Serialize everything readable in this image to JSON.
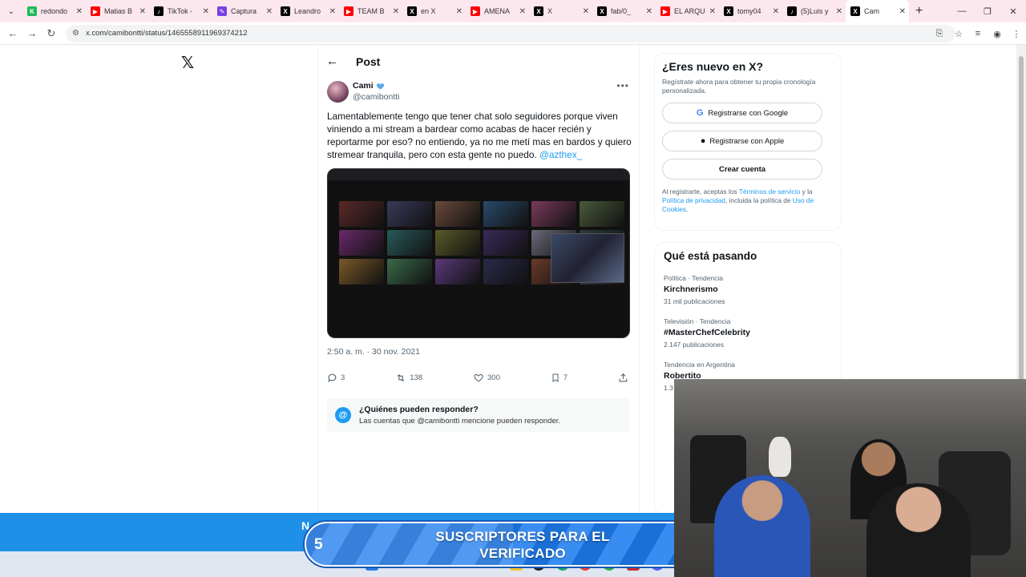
{
  "browser": {
    "tabs": [
      {
        "title": "redondo",
        "color": "#1db954",
        "glyph": "K"
      },
      {
        "title": "Matias B",
        "color": "#ff0000",
        "glyph": "▶"
      },
      {
        "title": "TikTok -",
        "color": "#000000",
        "glyph": "♪"
      },
      {
        "title": "Captura",
        "color": "#7b3fe4",
        "glyph": "✎"
      },
      {
        "title": "Leandro",
        "color": "#000000",
        "glyph": "X"
      },
      {
        "title": "TEAM B",
        "color": "#ff0000",
        "glyph": "▶"
      },
      {
        "title": "en X",
        "color": "#000000",
        "glyph": "X"
      },
      {
        "title": "AMENA",
        "color": "#ff0000",
        "glyph": "▶"
      },
      {
        "title": "X",
        "color": "#000000",
        "glyph": "X"
      },
      {
        "title": "fab/0_",
        "color": "#000000",
        "glyph": "X"
      },
      {
        "title": "EL ARQU",
        "color": "#ff0000",
        "glyph": "▶"
      },
      {
        "title": "tomy04",
        "color": "#000000",
        "glyph": "X"
      },
      {
        "title": "(5)Luis y",
        "color": "#000000",
        "glyph": "♪"
      },
      {
        "title": "Cam",
        "color": "#000000",
        "glyph": "X"
      }
    ],
    "url": "x.com/camibontti/status/1465558911969374212"
  },
  "page": {
    "header_title": "Post",
    "author_name": "Cami",
    "author_handle": "@camibontti",
    "post_text": "Lamentablemente tengo que tener chat solo seguidores porque viven viniendo a mi stream a bardear como acabas de hacer recién y reportarme por eso? no entiendo, ya no me metí mas en bardos y quiero stremear tranquila, pero con esta gente no puedo. ",
    "post_mention": "@azthex_",
    "timestamp": "2:50 a. m. · 30 nov. 2021",
    "replies": "3",
    "reposts": "138",
    "likes": "300",
    "bookmarks": "7",
    "reply_title": "¿Quiénes pueden responder?",
    "reply_sub": "Las cuentas que @camibontti mencione pueden responder."
  },
  "signup": {
    "title": "¿Eres nuevo en X?",
    "subtitle": "Regístrate ahora para obtener tu propia cronología personalizada.",
    "google_label": "Registrarse con Google",
    "apple_label": "Registrarse con Apple",
    "create_label": "Crear cuenta",
    "legal_1": "Al registrarte, aceptas los ",
    "legal_terms": "Términos de servicio",
    "legal_2": " y la ",
    "legal_privacy": "Política de privacidad",
    "legal_3": ", incluida la política de ",
    "legal_cookies": "Uso de Cookies",
    "legal_4": "."
  },
  "trends": {
    "title": "Qué está pasando",
    "items": [
      {
        "category": "Política · Tendencia",
        "name": "Kirchnerismo",
        "count": "31 mil publicaciones"
      },
      {
        "category": "Televisión · Tendencia",
        "name": "#MasterChefCelebrity",
        "count": "2.147 publicaciones"
      },
      {
        "category": "Tendencia en Argentina",
        "name": "Robertito",
        "count": "1.3"
      }
    ]
  },
  "overlay": {
    "banner_partial": "N",
    "goal_current": "5",
    "goal_target": "10",
    "goal_progress": 0.5,
    "goal_text": "SUSCRIPTORES PARA EL VERIFICADO"
  },
  "colors": {
    "accent": "#1d9bf0",
    "banner": "#1e90e8"
  }
}
